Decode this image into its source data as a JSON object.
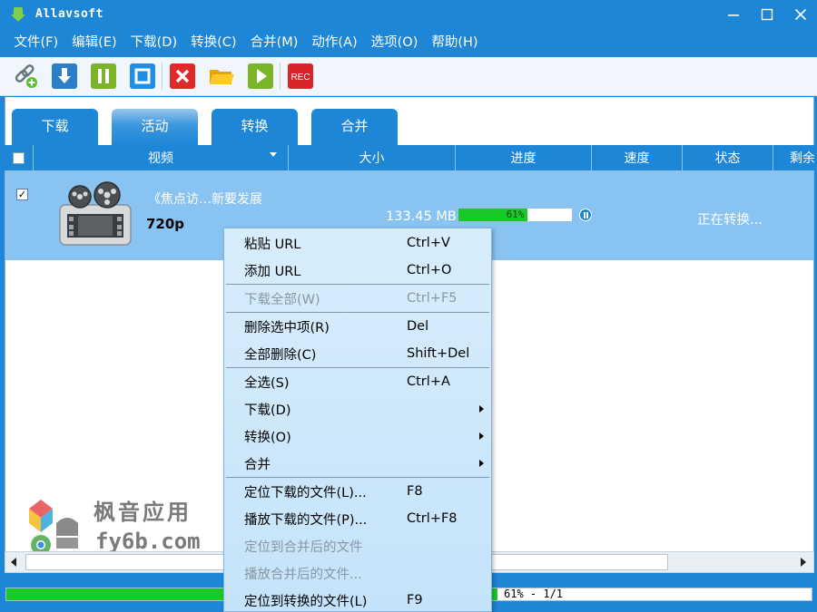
{
  "window": {
    "title": "Allavsoft"
  },
  "menu": [
    "文件(F)",
    "编辑(E)",
    "下载(D)",
    "转换(C)",
    "合并(M)",
    "动作(A)",
    "选项(O)",
    "帮助(H)"
  ],
  "toolbar": {
    "rec_label": "REC",
    "icons": [
      "add-url-icon",
      "download-icon",
      "pause-icon",
      "stop-icon",
      "delete-icon",
      "open-folder-icon",
      "play-icon",
      "record-icon"
    ]
  },
  "tabs": [
    {
      "label": "下载",
      "active": false
    },
    {
      "label": "活动",
      "active": true
    },
    {
      "label": "转换",
      "active": false
    },
    {
      "label": "合并",
      "active": false
    }
  ],
  "columns": [
    "视频",
    "大小",
    "进度",
    "速度",
    "状态",
    "剩余"
  ],
  "row": {
    "checked": true,
    "title": "《焦点访…新要发展",
    "resolution": "720p",
    "size": "133.45 MB",
    "progress_percent": 61,
    "progress_label": "61%",
    "status": "正在转换..."
  },
  "context_menu": [
    {
      "label": "粘贴 URL",
      "shortcut": "Ctrl+V",
      "disabled": false
    },
    {
      "label": "添加 URL",
      "shortcut": "Ctrl+O",
      "disabled": false
    },
    {
      "label": "下载全部(W)",
      "shortcut": "Ctrl+F5",
      "disabled": true
    },
    {
      "label": "删除选中项(R)",
      "shortcut": "Del",
      "disabled": false
    },
    {
      "label": "全部删除(C)",
      "shortcut": "Shift+Del",
      "disabled": false
    },
    {
      "label": "全选(S)",
      "shortcut": "Ctrl+A",
      "disabled": false
    },
    {
      "label": "下载(D)",
      "shortcut": "",
      "disabled": false,
      "submenu": true
    },
    {
      "label": "转换(O)",
      "shortcut": "",
      "disabled": false,
      "submenu": true
    },
    {
      "label": "合并",
      "shortcut": "",
      "disabled": false,
      "submenu": true
    },
    {
      "label": "定位下载的文件(L)...",
      "shortcut": "F8",
      "disabled": false
    },
    {
      "label": "播放下载的文件(P)...",
      "shortcut": "Ctrl+F8",
      "disabled": false
    },
    {
      "label": "定位到合并后的文件",
      "shortcut": "",
      "disabled": true
    },
    {
      "label": "播放合并后的文件...",
      "shortcut": "",
      "disabled": true
    },
    {
      "label": "定位到转换的文件(L)",
      "shortcut": "F9",
      "disabled": false
    }
  ],
  "statusbar": {
    "progress_percent": 61,
    "text": "61% - 1/1"
  },
  "watermark": {
    "line1": "枫音应用",
    "line2": "fy6b.com"
  },
  "colors": {
    "accent": "#1e86d6",
    "progress": "#18c928",
    "row_selected": "#88c3f2",
    "menu_bg": "#c4e3fa"
  }
}
